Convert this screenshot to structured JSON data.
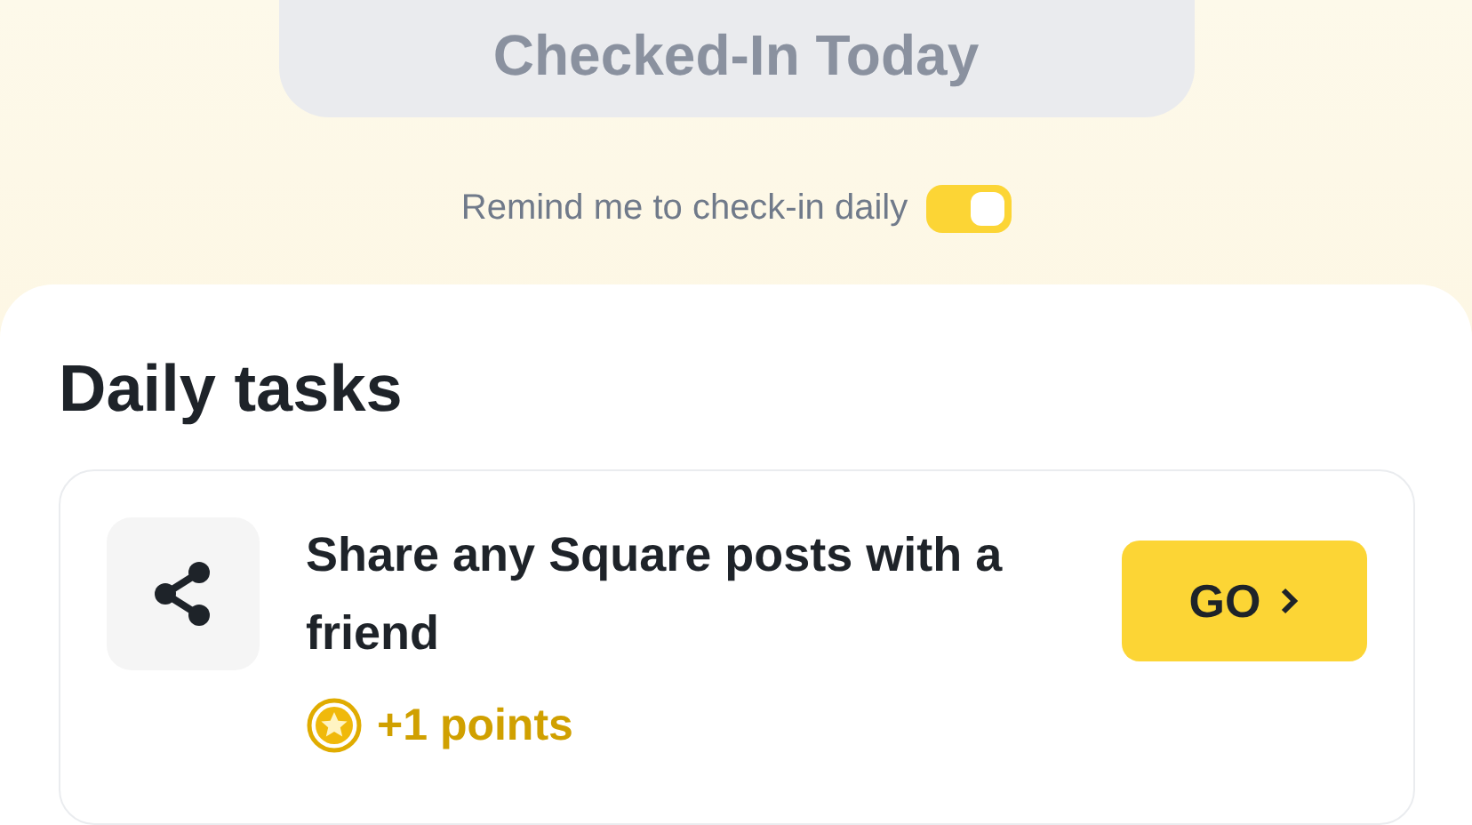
{
  "checkin_button": {
    "label": "Checked-In Today",
    "disabled": true
  },
  "reminder": {
    "label": "Remind me to check-in daily",
    "on": true
  },
  "daily_tasks": {
    "title": "Daily tasks",
    "tasks": [
      {
        "title": "Share any Square posts with a friend",
        "reward": "+1 points",
        "button": "GO"
      }
    ]
  }
}
